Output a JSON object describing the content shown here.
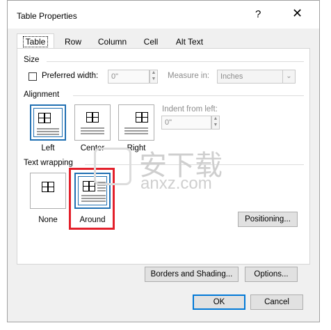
{
  "dialog": {
    "title": "Table Properties",
    "help_label": "?",
    "close_label": "✕"
  },
  "tabs": [
    {
      "label": "Table",
      "selected": true
    },
    {
      "label": "Row",
      "selected": false
    },
    {
      "label": "Column",
      "selected": false
    },
    {
      "label": "Cell",
      "selected": false
    },
    {
      "label": "Alt Text",
      "selected": false
    }
  ],
  "size": {
    "section_label": "Size",
    "preferred_width_label": "Preferred width:",
    "preferred_width_checked": false,
    "preferred_width_value": "0\"",
    "measure_in_label": "Measure in:",
    "measure_in_value": "Inches"
  },
  "alignment": {
    "section_label": "Alignment",
    "options": [
      {
        "label": "Left",
        "selected": true
      },
      {
        "label": "Center",
        "selected": false
      },
      {
        "label": "Right",
        "selected": false
      }
    ],
    "indent_label": "Indent from left:",
    "indent_value": "0\""
  },
  "text_wrapping": {
    "section_label": "Text wrapping",
    "options": [
      {
        "label": "None",
        "selected": false
      },
      {
        "label": "Around",
        "selected": true
      }
    ],
    "positioning_label": "Positioning..."
  },
  "bottom": {
    "borders_label": "Borders and Shading...",
    "options_label": "Options...",
    "ok_label": "OK",
    "cancel_label": "Cancel"
  },
  "watermark": {
    "text": "安下载",
    "subtext": "anxz.com"
  },
  "colors": {
    "selection_blue": "#1f6fb2",
    "highlight_red": "#e3202b",
    "default_button": "#0078d7"
  }
}
